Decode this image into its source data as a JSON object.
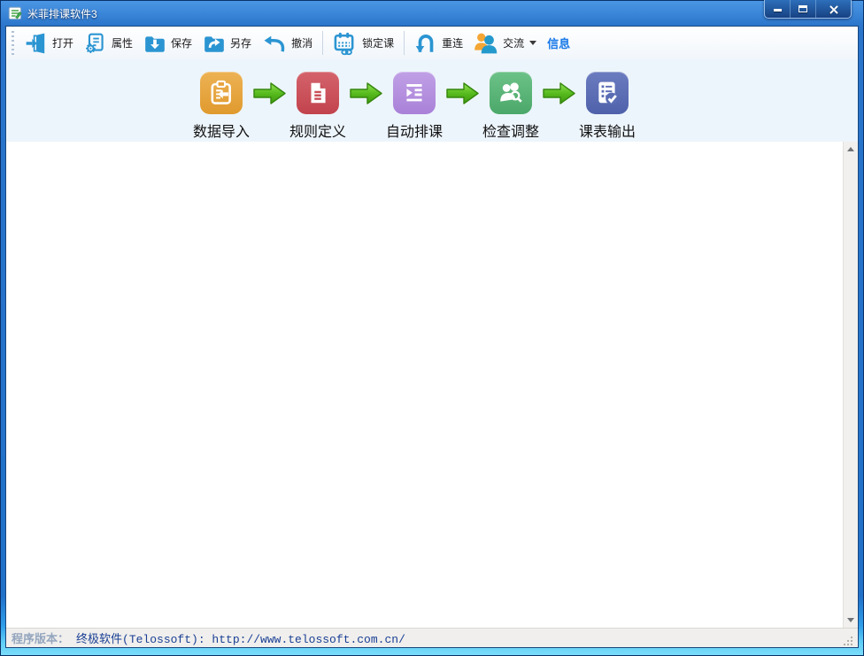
{
  "window": {
    "title": "米菲排课软件3",
    "titlebar_color": "#2A74CA",
    "controls": [
      {
        "name": "minimize"
      },
      {
        "name": "maximize"
      },
      {
        "name": "close"
      }
    ]
  },
  "toolbar": {
    "icon_color": "#2B95D2",
    "buttons": [
      {
        "label": "打开",
        "icon": "open-door-icon"
      },
      {
        "label": "属性",
        "icon": "properties-gear-icon"
      },
      {
        "label": "保存",
        "icon": "save-folder-icon"
      },
      {
        "label": "另存",
        "icon": "save-as-folder-icon"
      },
      {
        "label": "撤消",
        "icon": "undo-arrow-icon"
      },
      {
        "label": "锁定课",
        "icon": "lock-course-calendar-icon"
      },
      {
        "label": "重连",
        "icon": "reconnect-arrow-icon"
      },
      {
        "label": "交流",
        "icon": "people-icon",
        "has_dropdown": true
      },
      {
        "label": "信息",
        "style": "link",
        "color": "#1778E8"
      }
    ]
  },
  "workflow": {
    "strip_background": "#EDF5FC",
    "arrow_color": "#4CB122",
    "steps": [
      {
        "label": "数据导入",
        "icon": "data-import-icon",
        "color": "#E8A33E"
      },
      {
        "label": "规则定义",
        "icon": "rule-definition-icon",
        "color": "#C9505A"
      },
      {
        "label": "自动排课",
        "icon": "auto-schedule-icon",
        "color": "#B48FDC"
      },
      {
        "label": "检查调整",
        "icon": "check-adjust-icon",
        "color": "#57B377"
      },
      {
        "label": "课表输出",
        "icon": "timetable-output-icon",
        "color": "#5A6DB4"
      }
    ]
  },
  "statusbar": {
    "label": "程序版本：",
    "value": "终极软件(Telossoft): http://www.telossoft.com.cn/",
    "value_color": "#1A3F95"
  }
}
